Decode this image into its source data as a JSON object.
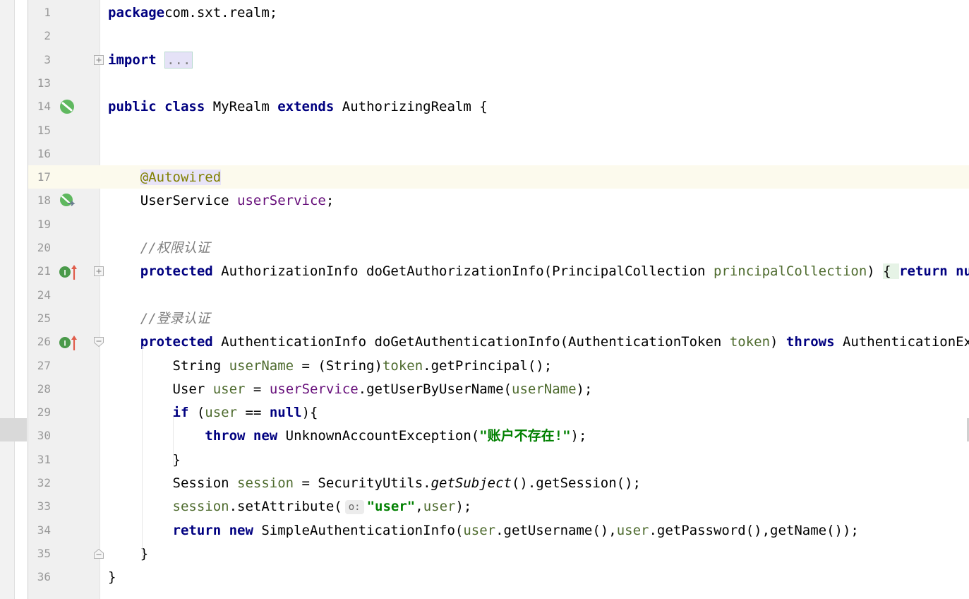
{
  "editor": {
    "lines": [
      {
        "num": "1",
        "t": [
          [
            "kw",
            "package"
          ],
          [
            "",
            "com.sxt.realm;"
          ]
        ]
      },
      {
        "num": "2",
        "t": []
      },
      {
        "num": "3",
        "fold": "plus",
        "t": [
          [
            "kw",
            "import"
          ],
          [
            "",
            " "
          ],
          [
            "folded",
            "..."
          ]
        ]
      },
      {
        "num": "13",
        "t": []
      },
      {
        "num": "14",
        "icon": "bean-icon",
        "t": [
          [
            "kw",
            "public class"
          ],
          [
            "",
            " MyRealm "
          ],
          [
            "kw",
            "extends"
          ],
          [
            "",
            " AuthorizingRealm {"
          ]
        ]
      },
      {
        "num": "15",
        "t": []
      },
      {
        "num": "16",
        "t": []
      },
      {
        "num": "17",
        "current": true,
        "t": [
          [
            "",
            "    "
          ],
          [
            "ann annbg",
            "@Autowired"
          ]
        ]
      },
      {
        "num": "18",
        "icon": "autowired-navigate-icon",
        "t": [
          [
            "",
            "    UserService "
          ],
          [
            "fld",
            "userService"
          ],
          [
            "",
            ";"
          ]
        ]
      },
      {
        "num": "19",
        "t": []
      },
      {
        "num": "20",
        "t": [
          [
            "",
            "    "
          ],
          [
            "cmt",
            "//权限认证"
          ]
        ]
      },
      {
        "num": "21",
        "icon": "implements-override-icon",
        "fold": "plus",
        "t": [
          [
            "",
            "    "
          ],
          [
            "kw",
            "protected"
          ],
          [
            "",
            " AuthorizationInfo doGetAuthorizationInfo(PrincipalCollection "
          ],
          [
            "par",
            "principalCollection"
          ],
          [
            "",
            ") "
          ],
          [
            "brace-green",
            "{ "
          ],
          [
            "kw",
            "return null"
          ]
        ]
      },
      {
        "num": "24",
        "t": []
      },
      {
        "num": "25",
        "t": [
          [
            "",
            "    "
          ],
          [
            "cmt",
            "//登录认证"
          ]
        ]
      },
      {
        "num": "26",
        "icon": "implements-override-icon",
        "fold": "minus",
        "t": [
          [
            "",
            "    "
          ],
          [
            "kw",
            "protected"
          ],
          [
            "",
            " AuthenticationInfo doGetAuthenticationInfo(AuthenticationToken "
          ],
          [
            "par",
            "token"
          ],
          [
            "",
            ") "
          ],
          [
            "kw",
            "throws"
          ],
          [
            "",
            " AuthenticationExcep"
          ]
        ]
      },
      {
        "num": "27",
        "t": [
          [
            "",
            "        String "
          ],
          [
            "par",
            "userName"
          ],
          [
            "",
            " = (String)"
          ],
          [
            "par",
            "token"
          ],
          [
            "",
            ".getPrincipal();"
          ]
        ]
      },
      {
        "num": "28",
        "t": [
          [
            "",
            "        User "
          ],
          [
            "par",
            "user"
          ],
          [
            "",
            " = "
          ],
          [
            "fld",
            "userService"
          ],
          [
            "",
            ".getUserByUserName("
          ],
          [
            "par",
            "userName"
          ],
          [
            "",
            ");"
          ]
        ]
      },
      {
        "num": "29",
        "t": [
          [
            "",
            "        "
          ],
          [
            "kw",
            "if"
          ],
          [
            "",
            " ("
          ],
          [
            "par",
            "user"
          ],
          [
            "",
            " == "
          ],
          [
            "kw",
            "null"
          ],
          [
            "",
            "){"
          ]
        ]
      },
      {
        "num": "30",
        "t": [
          [
            "",
            "            "
          ],
          [
            "kw",
            "throw new"
          ],
          [
            "",
            " UnknownAccountException("
          ],
          [
            "str",
            "\"账户不存在!\""
          ],
          [
            "",
            ");"
          ]
        ]
      },
      {
        "num": "31",
        "t": [
          [
            "",
            "        }"
          ]
        ]
      },
      {
        "num": "32",
        "t": [
          [
            "",
            "        Session "
          ],
          [
            "par",
            "session"
          ],
          [
            "",
            " = SecurityUtils."
          ],
          [
            "it",
            "getSubject"
          ],
          [
            "",
            "().getSession();"
          ]
        ]
      },
      {
        "num": "33",
        "t": [
          [
            "",
            "        "
          ],
          [
            "par",
            "session"
          ],
          [
            "",
            ".setAttribute("
          ],
          [
            "hint",
            "o:"
          ],
          [
            "str",
            "\"user\""
          ],
          [
            "",
            ","
          ],
          [
            "par",
            "user"
          ],
          [
            "",
            ");"
          ]
        ]
      },
      {
        "num": "34",
        "t": [
          [
            "",
            "        "
          ],
          [
            "kw",
            "return new"
          ],
          [
            "",
            " SimpleAuthenticationInfo("
          ],
          [
            "par",
            "user"
          ],
          [
            "",
            ".getUsername(),"
          ],
          [
            "par",
            "user"
          ],
          [
            "",
            ".getPassword(),getName());"
          ]
        ]
      },
      {
        "num": "35",
        "fold": "end",
        "t": [
          [
            "",
            "    }"
          ]
        ]
      },
      {
        "num": "36",
        "t": [
          [
            "",
            "}"
          ]
        ]
      }
    ]
  }
}
